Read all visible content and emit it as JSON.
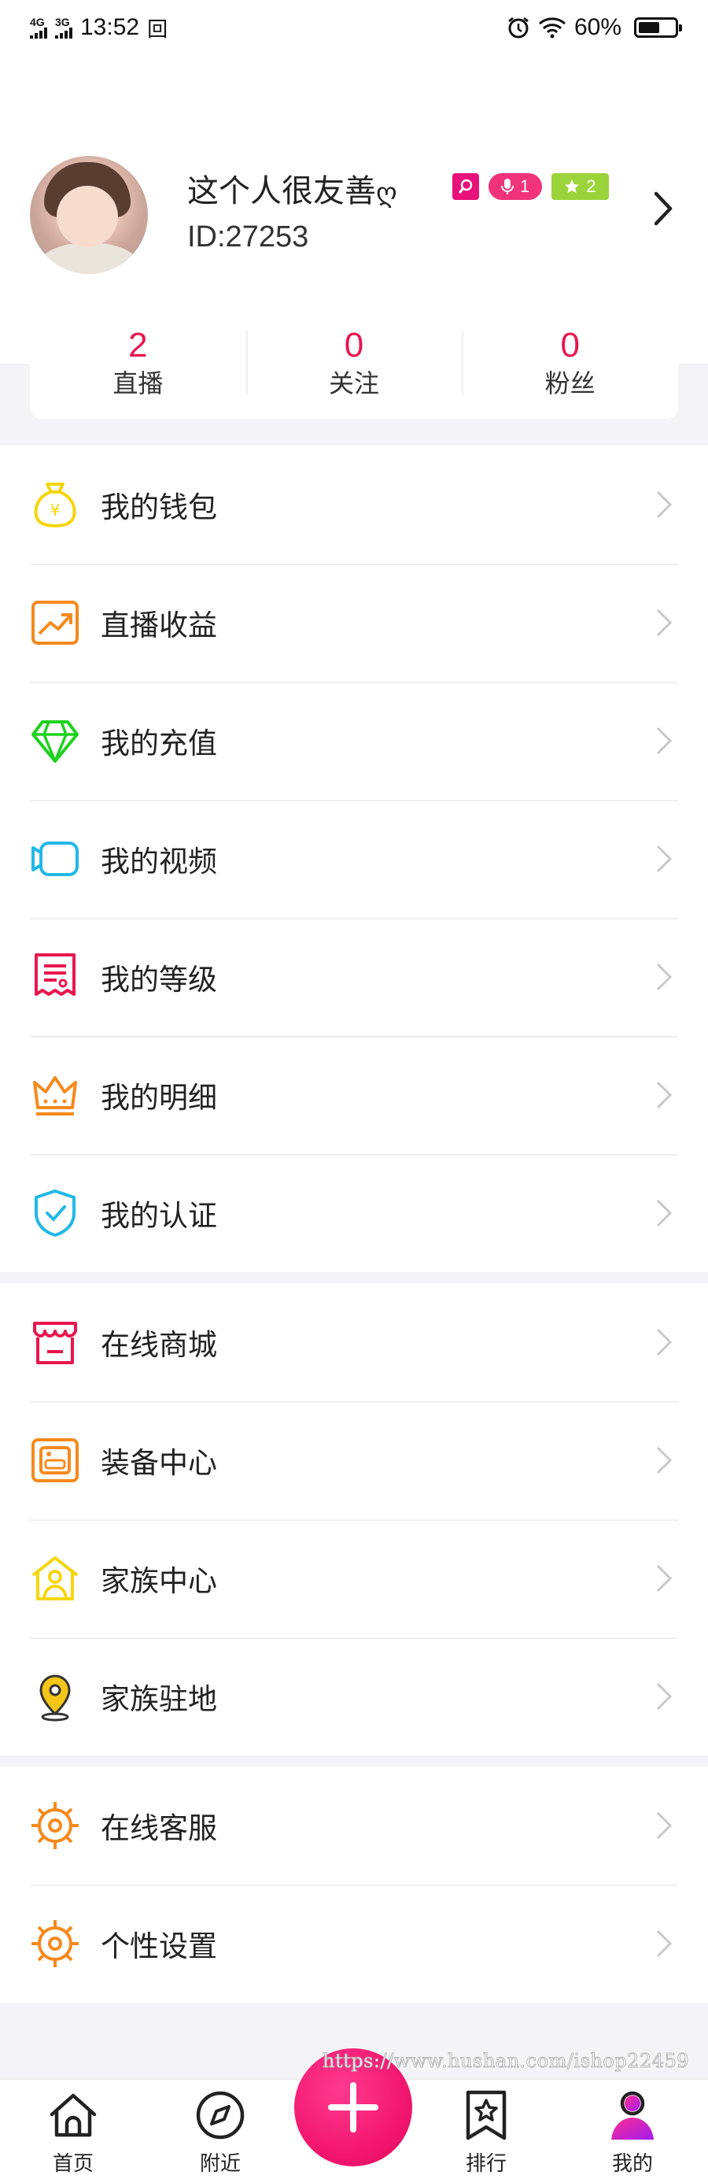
{
  "status_bar": {
    "net1": "4G",
    "net2": "3G",
    "time": "13:52",
    "sim_glyph": "回",
    "battery": "60%",
    "battery_level": 0.6
  },
  "profile": {
    "nickname": "这个人很友善",
    "nickname_mark": "ღ",
    "badges": {
      "host_level": "1",
      "user_level": "2"
    },
    "user_id": "ID:27253"
  },
  "stats": [
    {
      "value": "2",
      "label": "直播"
    },
    {
      "value": "0",
      "label": "关注"
    },
    {
      "value": "0",
      "label": "粉丝"
    }
  ],
  "menu_groups": [
    [
      {
        "label": "我的钱包",
        "icon": "wallet-icon",
        "color": "#f5d60f"
      },
      {
        "label": "直播收益",
        "icon": "earnings-chart-icon",
        "color": "#f58a1d"
      },
      {
        "label": "我的充值",
        "icon": "diamond-icon",
        "color": "#1fd11f"
      },
      {
        "label": "我的视频",
        "icon": "video-camera-icon",
        "color": "#22b8e8"
      },
      {
        "label": "我的等级",
        "icon": "level-receipt-icon",
        "color": "#e8174f"
      },
      {
        "label": "我的明细",
        "icon": "crown-icon",
        "color": "#f58a1d"
      },
      {
        "label": "我的认证",
        "icon": "shield-check-icon",
        "color": "#22b8e8"
      }
    ],
    [
      {
        "label": "在线商城",
        "icon": "shop-icon",
        "color": "#e8174f"
      },
      {
        "label": "装备中心",
        "icon": "equipment-icon",
        "color": "#f58a1d"
      },
      {
        "label": "家族中心",
        "icon": "family-home-icon",
        "color": "#f5d60f"
      },
      {
        "label": "家族驻地",
        "icon": "location-pin-icon",
        "color": "#e8b90f"
      }
    ],
    [
      {
        "label": "在线客服",
        "icon": "customer-service-icon",
        "color": "#f58a1d"
      },
      {
        "label": "个性设置",
        "icon": "settings-gear-icon",
        "color": "#f58a1d"
      }
    ]
  ],
  "watermark": "https://www.hushan.com/ishop22459",
  "tabbar": {
    "home": "首页",
    "nearby": "附近",
    "ranking": "排行",
    "mine": "我的",
    "accent": "#e8174f"
  }
}
